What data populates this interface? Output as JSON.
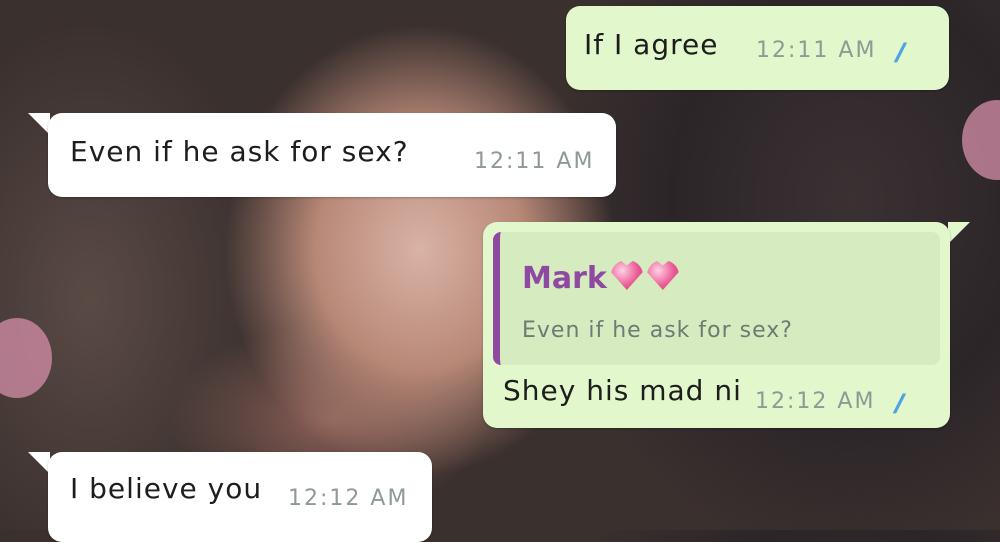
{
  "messages": [
    {
      "direction": "outgoing",
      "text": "If I agree",
      "time": "12:11 AM",
      "ticks": "//",
      "status": "read"
    },
    {
      "direction": "incoming",
      "text": "Even if he ask for sex?",
      "time": "12:11 AM"
    },
    {
      "direction": "outgoing",
      "reply_to": {
        "author": "Mark",
        "author_emoji": "💖💖",
        "text": "Even if he ask for sex?"
      },
      "text": "Shey his mad ni",
      "time": "12:12 AM",
      "ticks": "//",
      "status": "read"
    },
    {
      "direction": "incoming",
      "text": "I believe you",
      "time": "12:12 AM"
    }
  ],
  "colors": {
    "incoming_bubble": "#ffffff",
    "outgoing_bubble": "#e2f7cb",
    "quote_accent": "#8e4aa0",
    "read_ticks": "#4ea4e0"
  }
}
